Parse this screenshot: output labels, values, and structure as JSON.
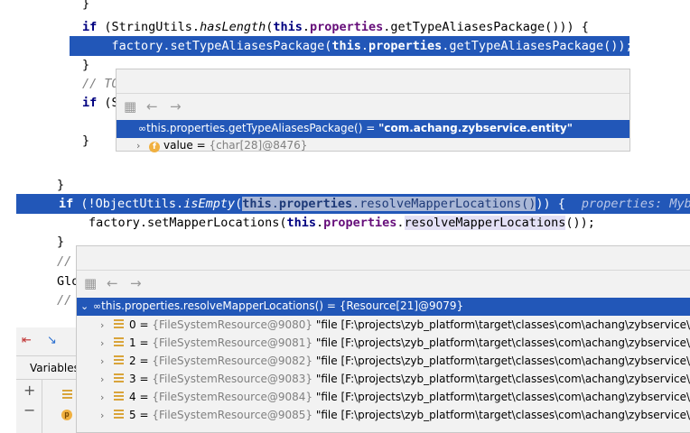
{
  "top": {
    "brace_partial": "}",
    "line_if": {
      "kw_if": "if",
      "open": " (StringUtils.",
      "method": "hasLength",
      "paren": "(",
      "kw_this": "this",
      "dot1": ".",
      "field": "properties",
      "rest": ".getTypeAliasesPackage())) {"
    },
    "line_call": {
      "indent": "    ",
      "pre": "factory.setTypeAliasesPackage(",
      "kw_this": "this",
      "dot": ".",
      "field": "properties",
      "rest": ".getTypeAliasesPackage());"
    },
    "brace_close": "}",
    "comment_partial": "// TO",
    "if_partial": "if (S",
    "brace_close2": "}",
    "popup": {
      "expr": "this.properties.getTypeAliasesPackage() = ",
      "value": "\"com.achang.zybservice.entity\"",
      "child_name": "value",
      "child_eq": " = ",
      "child_value": "{char[28]@8476}"
    }
  },
  "bottom": {
    "brace_close": "}",
    "line_if": {
      "kw_if": "if",
      "open": " (!ObjectUtils.",
      "method": "isEmpty",
      "paren": "(",
      "kw_this": "this",
      "dot": ".",
      "field": "properties",
      "rest": ".resolveMapperLocations()",
      "close": ")) {",
      "hint": "properties: Myba"
    },
    "line_call": {
      "pre": "factory.setMapperLocations(",
      "kw_this": "this",
      "dot": ".",
      "field": "properties",
      "dot2": ".",
      "method": "resolveMapperLocations",
      "rest": "());"
    },
    "brace_close2": "}",
    "comment1": "//",
    "glo": "Glo",
    "comment2": "//",
    "popup": {
      "expr": "this.properties.resolveMapperLocations() = {Resource[21]@9079}",
      "rows": [
        {
          "index": "0",
          "ref": "{FileSystemResource@9080}",
          "text": "\"file [F:\\projects\\zyb_platform\\target\\classes\\com\\achang\\zybservice\\ma"
        },
        {
          "index": "1",
          "ref": "{FileSystemResource@9081}",
          "text": "\"file [F:\\projects\\zyb_platform\\target\\classes\\com\\achang\\zybservice\\ma"
        },
        {
          "index": "2",
          "ref": "{FileSystemResource@9082}",
          "text": "\"file [F:\\projects\\zyb_platform\\target\\classes\\com\\achang\\zybservice\\ma"
        },
        {
          "index": "3",
          "ref": "{FileSystemResource@9083}",
          "text": "\"file [F:\\projects\\zyb_platform\\target\\classes\\com\\achang\\zybservice\\ma"
        },
        {
          "index": "4",
          "ref": "{FileSystemResource@9084}",
          "text": "\"file [F:\\projects\\zyb_platform\\target\\classes\\com\\achang\\zybservice\\ma"
        },
        {
          "index": "5",
          "ref": "{FileSystemResource@9085}",
          "text": "\"file [F:\\projects\\zyb_platform\\target\\classes\\com\\achang\\zybservice\\ma"
        }
      ]
    },
    "debug_panel": {
      "tab_label": "Variables",
      "p_icon": "p"
    }
  }
}
